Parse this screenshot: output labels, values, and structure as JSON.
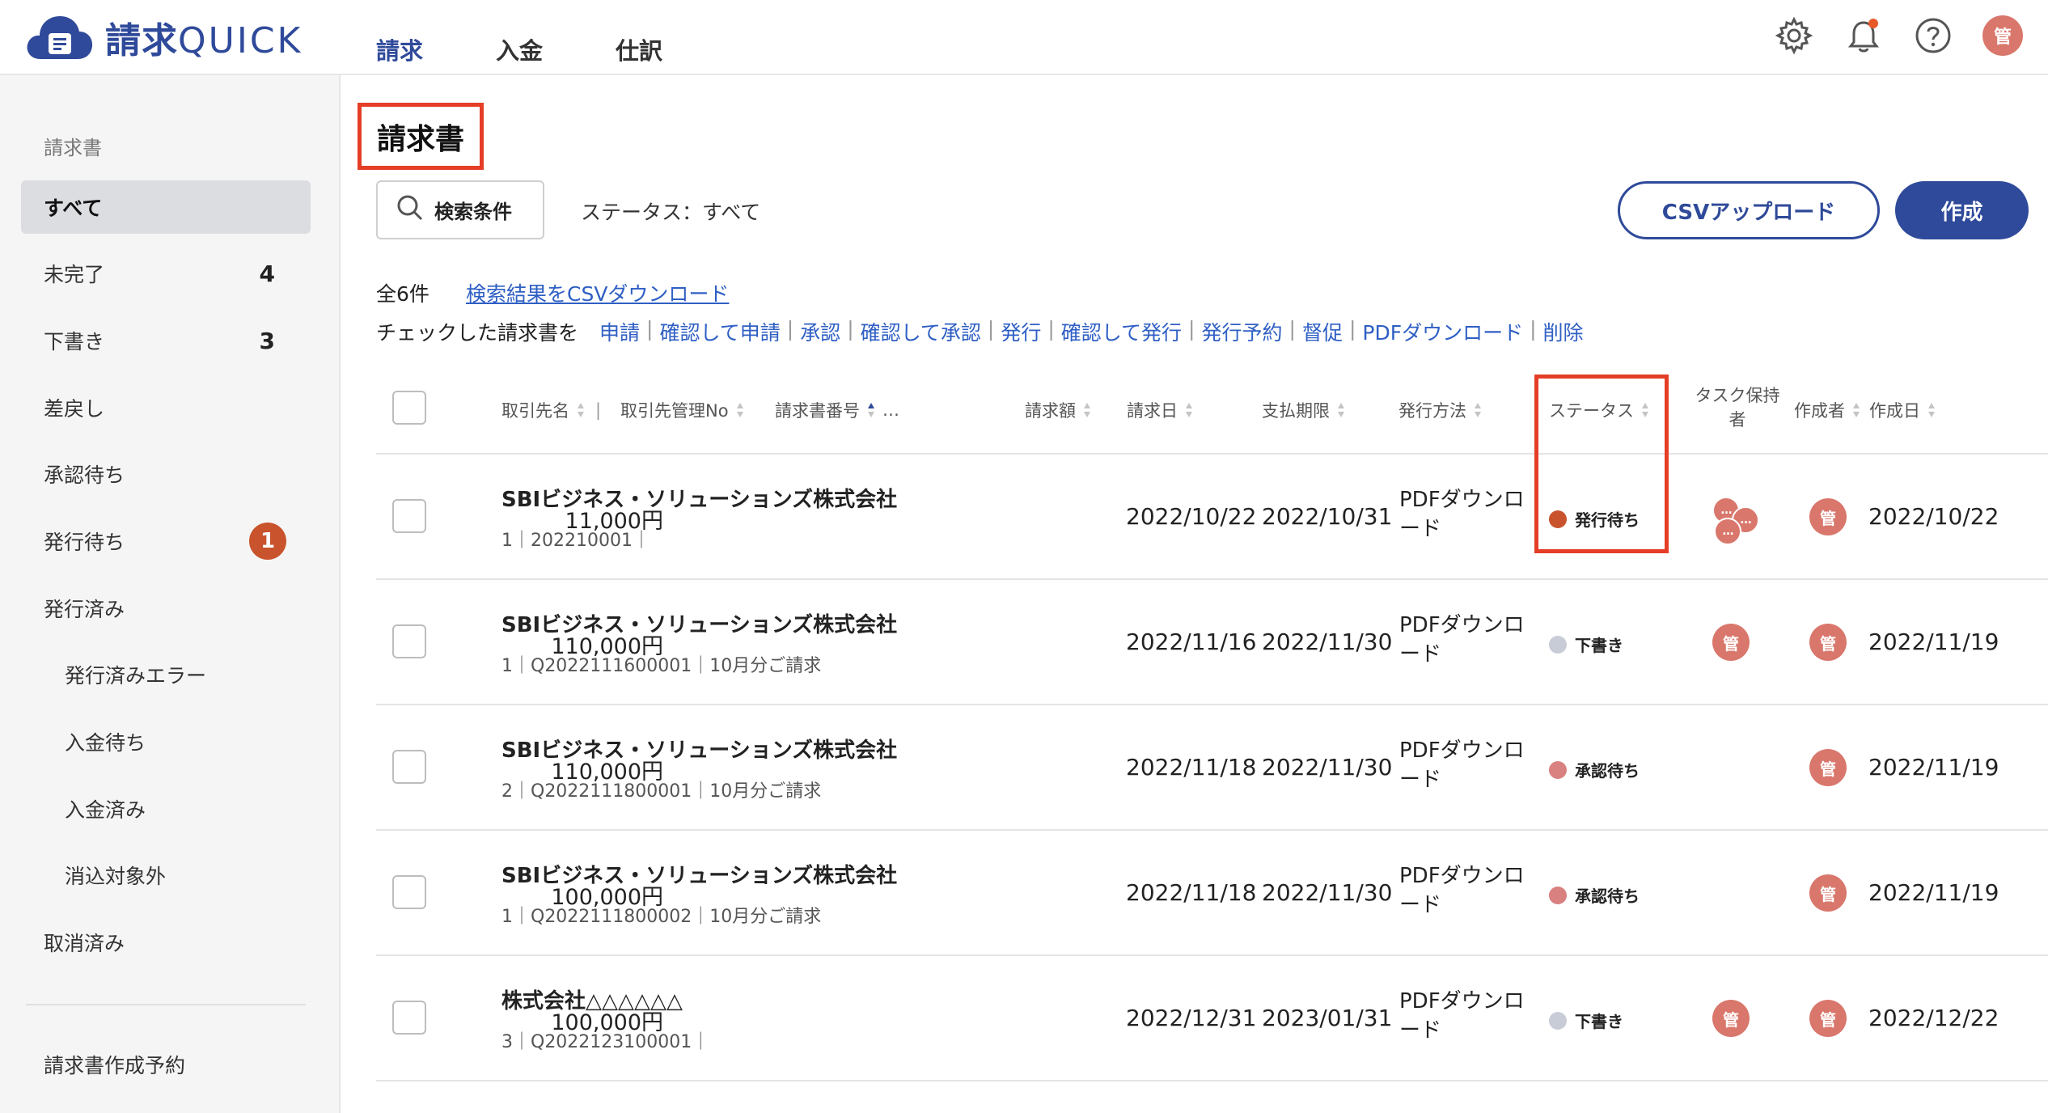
{
  "app": {
    "logo_text": "請求QUICK",
    "logo_kanji": "請求",
    "logo_latin": "QUICK"
  },
  "nav": {
    "tabs": [
      {
        "label": "請求",
        "active": true
      },
      {
        "label": "入金",
        "active": false
      },
      {
        "label": "仕訳",
        "active": false
      }
    ]
  },
  "header_icons": {
    "settings": "gear-icon",
    "notifications": "bell-icon",
    "help": "help-icon",
    "user_avatar": "管"
  },
  "sidebar": {
    "section_title": "請求書",
    "items": [
      {
        "label": "すべて",
        "active": true
      },
      {
        "label": "未完了",
        "count": "4"
      },
      {
        "label": "下書き",
        "count": "3"
      },
      {
        "label": "差戻し"
      },
      {
        "label": "承認待ち"
      },
      {
        "label": "発行待ち",
        "badge": "1"
      },
      {
        "label": "発行済み"
      },
      {
        "label": "発行済みエラー",
        "sub": true
      },
      {
        "label": "入金待ち",
        "sub": true
      },
      {
        "label": "入金済み",
        "sub": true
      },
      {
        "label": "消込対象外",
        "sub": true
      },
      {
        "label": "取消済み"
      },
      {
        "label": "請求書作成予約"
      }
    ]
  },
  "main": {
    "page_title": "請求書",
    "search_button": "検索条件",
    "status_filter": "ステータス：すべて",
    "csv_upload": "CSVアップロード",
    "create": "作成",
    "result_count": "全6件",
    "csv_download": "検索結果をCSVダウンロード",
    "bulk_label": "チェックした請求書を",
    "bulk_actions": [
      "申請",
      "確認して申請",
      "承認",
      "確認して承認",
      "発行",
      "確認して発行",
      "発行予約",
      "督促",
      "PDFダウンロード",
      "削除"
    ]
  },
  "table": {
    "headers": {
      "client": "取引先名",
      "client_no": "取引先管理No",
      "invoice_no": "請求書番号",
      "more": "…",
      "amount": "請求額",
      "invoice_date": "請求日",
      "due_date": "支払期限",
      "method": "発行方法",
      "status": "ステータス",
      "task_holder": "タスク保持者",
      "creator": "作成者",
      "created": "作成日"
    },
    "rows": [
      {
        "client": "SBIビジネス・ソリューションズ株式会社",
        "sub": "1｜202210001｜",
        "amount": "11,000円",
        "invoice_date": "2022/10/22",
        "due_date": "2022/10/31",
        "method": "PDFダウンロード",
        "status": "発行待ち",
        "status_color": "#c8532c",
        "task": "multi",
        "task_label": "…",
        "creator": "管",
        "created": "2022/10/22"
      },
      {
        "client": "SBIビジネス・ソリューションズ株式会社",
        "sub": "1｜Q2022111600001｜10月分ご請求",
        "amount": "110,000円",
        "invoice_date": "2022/11/16",
        "due_date": "2022/11/30",
        "method": "PDFダウンロード",
        "status": "下書き",
        "status_color": "#c7ccd6",
        "task": "single",
        "task_label": "管",
        "creator": "管",
        "created": "2022/11/19"
      },
      {
        "client": "SBIビジネス・ソリューションズ株式会社",
        "sub": "2｜Q2022111800001｜10月分ご請求",
        "amount": "110,000円",
        "invoice_date": "2022/11/18",
        "due_date": "2022/11/30",
        "method": "PDFダウンロード",
        "status": "承認待ち",
        "status_color": "#d98080",
        "task": "none",
        "creator": "管",
        "created": "2022/11/19"
      },
      {
        "client": "SBIビジネス・ソリューションズ株式会社",
        "sub": "1｜Q2022111800002｜10月分ご請求",
        "amount": "100,000円",
        "invoice_date": "2022/11/18",
        "due_date": "2022/11/30",
        "method": "PDFダウンロード",
        "status": "承認待ち",
        "status_color": "#d98080",
        "task": "none",
        "creator": "管",
        "created": "2022/11/19"
      },
      {
        "client": "株式会社△△△△△△",
        "sub": "3｜Q2022123100001｜",
        "amount": "100,000円",
        "invoice_date": "2022/12/31",
        "due_date": "2023/01/31",
        "method": "PDFダウンロード",
        "status": "下書き",
        "status_color": "#c7ccd6",
        "task": "single",
        "task_label": "管",
        "creator": "管",
        "created": "2022/12/22"
      }
    ]
  },
  "colors": {
    "brand": "#2f4a9a",
    "link": "#2f5fc4",
    "highlight": "#e53e27",
    "avatar": "#d9776c",
    "badge": "#c8532c"
  }
}
